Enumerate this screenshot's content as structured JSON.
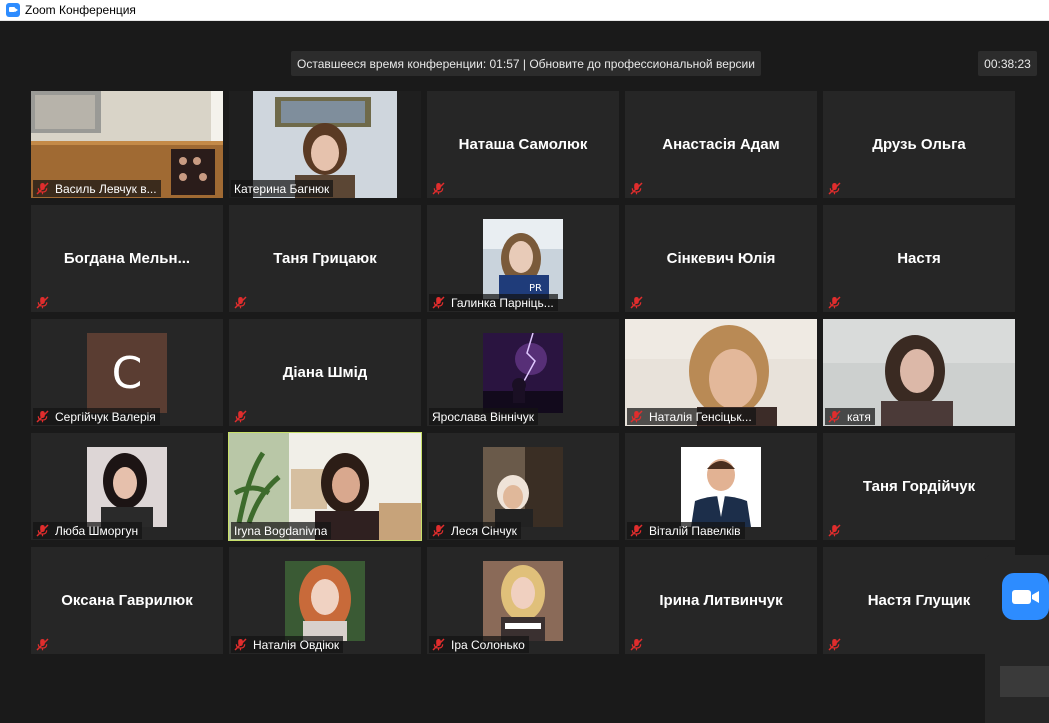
{
  "window": {
    "title": "Zoom Конференция"
  },
  "banner": {
    "notice": "Оставшееся время конференции: 01:57 | Обновите до профессиональной версии",
    "timer": "00:38:23"
  },
  "colors": {
    "accent": "#2d8cff",
    "active_speaker": "#c8e06a",
    "muted": "#e02d2d"
  },
  "participants": [
    {
      "name": "Василь Левчук в...",
      "mode": "video",
      "muted": true
    },
    {
      "name": "Катерина Багнюк",
      "mode": "video",
      "muted": false
    },
    {
      "name": "Наташа Самолюк",
      "mode": "name",
      "muted": true
    },
    {
      "name": "Анастасія Адам",
      "mode": "name",
      "muted": true
    },
    {
      "name": "Друзь Ольга",
      "mode": "name",
      "muted": true
    },
    {
      "name": "Богдана  Мельн...",
      "mode": "name",
      "muted": true
    },
    {
      "name": "Таня Грицаюк",
      "mode": "name",
      "muted": true
    },
    {
      "name": "Галинка Парніць...",
      "mode": "avatar",
      "muted": true
    },
    {
      "name": "Сінкевич Юлія",
      "mode": "name",
      "muted": true
    },
    {
      "name": "Настя",
      "mode": "name",
      "muted": true
    },
    {
      "name": "Сергійчук Валерія",
      "mode": "letter",
      "letter": "С",
      "muted": true
    },
    {
      "name": "Діана Шмід",
      "mode": "name",
      "muted": true
    },
    {
      "name": "Ярослава Віннічук",
      "mode": "avatar",
      "muted": false
    },
    {
      "name": "Наталія Генсіцьк...",
      "mode": "video",
      "muted": true
    },
    {
      "name": "катя",
      "mode": "video",
      "muted": true
    },
    {
      "name": "Люба Шморгун",
      "mode": "avatar",
      "muted": true
    },
    {
      "name": "Iryna Bogdanivna",
      "mode": "video",
      "muted": false,
      "active": true
    },
    {
      "name": "Леся Сінчук",
      "mode": "avatar",
      "muted": true
    },
    {
      "name": "Віталій Павелків",
      "mode": "avatar",
      "muted": true
    },
    {
      "name": "Таня Гордійчук",
      "mode": "name",
      "muted": true
    },
    {
      "name": "Оксана Гаврилюк",
      "mode": "name",
      "muted": true
    },
    {
      "name": "Наталія Овдіюк",
      "mode": "avatar",
      "muted": true
    },
    {
      "name": "Іра Солонько",
      "mode": "avatar",
      "muted": true
    },
    {
      "name": "Ірина Литвинчук",
      "mode": "name",
      "muted": true
    },
    {
      "name": "Настя Глущик",
      "mode": "name",
      "muted": true
    }
  ],
  "floating_control": {
    "icon": "video-camera-icon"
  }
}
